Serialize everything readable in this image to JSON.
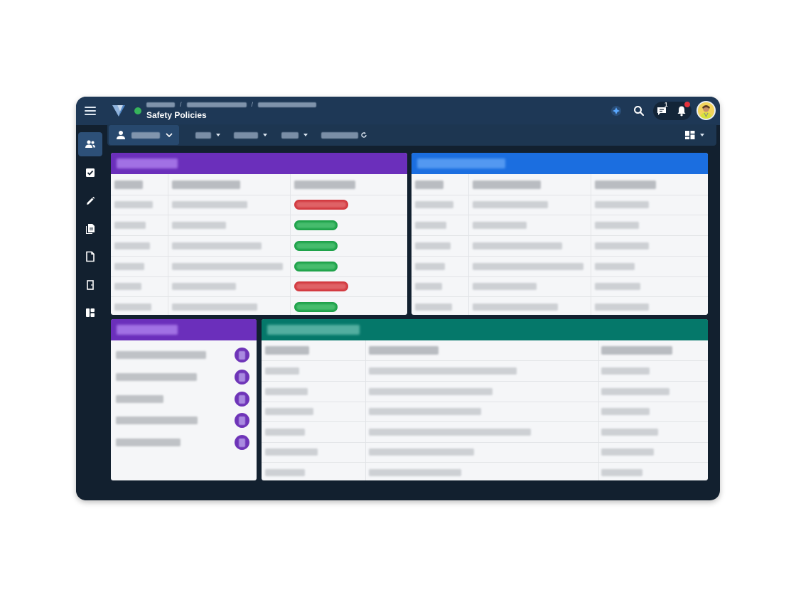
{
  "header": {
    "title": "Safety Policies",
    "breadcrumb_separators": [
      "/",
      "/"
    ],
    "chat_count": "1"
  },
  "colors": {
    "purple_header": "#6b2fbb",
    "blue_header": "#1b6ee0",
    "teal_header": "#05786a",
    "status_red": "#d23a40",
    "status_green": "#1ea24a",
    "sidebar_active": "#2d5078",
    "app_header": "#1e3856"
  },
  "sidebar": {
    "items": [
      {
        "icon": "users-icon",
        "active": true
      },
      {
        "icon": "checkbox-icon",
        "active": false
      },
      {
        "icon": "pencil-icon",
        "active": false
      },
      {
        "icon": "documents-icon",
        "active": false
      },
      {
        "icon": "document-icon",
        "active": false
      },
      {
        "icon": "door-icon",
        "active": false
      },
      {
        "icon": "dashboard-icon",
        "active": false
      }
    ]
  },
  "panels": {
    "purple_table": {
      "status_pills": [
        "red",
        "green",
        "green",
        "green",
        "red",
        "green"
      ]
    },
    "purple_list": {
      "item_count": 5
    }
  }
}
